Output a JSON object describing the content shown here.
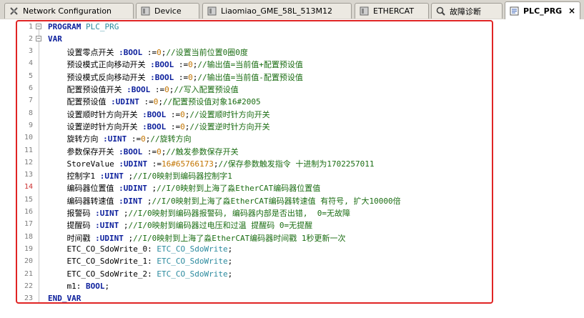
{
  "tabs": [
    {
      "label": "Network Configuration",
      "icon": "network-config-icon",
      "active": false
    },
    {
      "label": "Device",
      "icon": "device-icon",
      "active": false
    },
    {
      "label": "Liaomiao_GME_58L_513M12",
      "icon": "device-icon",
      "active": false
    },
    {
      "label": "ETHERCAT",
      "icon": "ethercat-icon",
      "active": false
    },
    {
      "label": "故障诊断",
      "icon": "diagnosis-icon",
      "active": false
    },
    {
      "label": "PLC_PRG",
      "icon": "program-icon",
      "active": true,
      "close": "×"
    }
  ],
  "editor": {
    "current_line": 14,
    "lines": [
      [
        {
          "t": "PROGRAM ",
          "c": "kw"
        },
        {
          "t": "PLC_PRG",
          "c": "ty"
        }
      ],
      [
        {
          "t": "VAR",
          "c": "kw"
        }
      ],
      [
        {
          "t": "    设置零点开关 ",
          "c": "ident"
        },
        {
          "t": ":BOOL",
          "c": "kw"
        },
        {
          "t": " :=",
          "c": "ident"
        },
        {
          "t": "0",
          "c": "num"
        },
        {
          "t": ";",
          "c": "ident"
        },
        {
          "t": "//设置当前位置0圈0度",
          "c": "cmt"
        }
      ],
      [
        {
          "t": "    预设模式正向移动开关 ",
          "c": "ident"
        },
        {
          "t": ":BOOL",
          "c": "kw"
        },
        {
          "t": " :=",
          "c": "ident"
        },
        {
          "t": "0",
          "c": "num"
        },
        {
          "t": ";",
          "c": "ident"
        },
        {
          "t": "//输出值=当前值+配置预设值",
          "c": "cmt"
        }
      ],
      [
        {
          "t": "    预设模式反向移动开关 ",
          "c": "ident"
        },
        {
          "t": ":BOOL",
          "c": "kw"
        },
        {
          "t": " :=",
          "c": "ident"
        },
        {
          "t": "0",
          "c": "num"
        },
        {
          "t": ";",
          "c": "ident"
        },
        {
          "t": "//输出值=当前值-配置预设值",
          "c": "cmt"
        }
      ],
      [
        {
          "t": "    配置预设值开关 ",
          "c": "ident"
        },
        {
          "t": ":BOOL",
          "c": "kw"
        },
        {
          "t": " :=",
          "c": "ident"
        },
        {
          "t": "0",
          "c": "num"
        },
        {
          "t": ";",
          "c": "ident"
        },
        {
          "t": "//写入配置预设值",
          "c": "cmt"
        }
      ],
      [
        {
          "t": "    配置预设值 ",
          "c": "ident"
        },
        {
          "t": ":UDINT",
          "c": "kw"
        },
        {
          "t": " :=",
          "c": "ident"
        },
        {
          "t": "0",
          "c": "num"
        },
        {
          "t": ";",
          "c": "ident"
        },
        {
          "t": "//配置预设值对象16#2005",
          "c": "cmt"
        }
      ],
      [
        {
          "t": "    设置顺时针方向开关 ",
          "c": "ident"
        },
        {
          "t": ":BOOL",
          "c": "kw"
        },
        {
          "t": " :=",
          "c": "ident"
        },
        {
          "t": "0",
          "c": "num"
        },
        {
          "t": ";",
          "c": "ident"
        },
        {
          "t": "//设置顺时针方向开关",
          "c": "cmt"
        }
      ],
      [
        {
          "t": "    设置逆时针方向开关 ",
          "c": "ident"
        },
        {
          "t": ":BOOL",
          "c": "kw"
        },
        {
          "t": " :=",
          "c": "ident"
        },
        {
          "t": "0",
          "c": "num"
        },
        {
          "t": ";",
          "c": "ident"
        },
        {
          "t": "//设置逆时针方向开关",
          "c": "cmt"
        }
      ],
      [
        {
          "t": "    旋转方向 ",
          "c": "ident"
        },
        {
          "t": ":UINT",
          "c": "kw"
        },
        {
          "t": " :=",
          "c": "ident"
        },
        {
          "t": "0",
          "c": "num"
        },
        {
          "t": ";",
          "c": "ident"
        },
        {
          "t": "//旋转方向",
          "c": "cmt"
        }
      ],
      [
        {
          "t": "    参数保存开关 ",
          "c": "ident"
        },
        {
          "t": ":BOOL",
          "c": "kw"
        },
        {
          "t": " :=",
          "c": "ident"
        },
        {
          "t": "0",
          "c": "num"
        },
        {
          "t": ";",
          "c": "ident"
        },
        {
          "t": "//触发参数保存开关",
          "c": "cmt"
        }
      ],
      [
        {
          "t": "    StoreValue ",
          "c": "ident"
        },
        {
          "t": ":UDINT",
          "c": "kw"
        },
        {
          "t": " :=",
          "c": "ident"
        },
        {
          "t": "16#65766173",
          "c": "num"
        },
        {
          "t": ";",
          "c": "ident"
        },
        {
          "t": "//保存参数触发指令 十进制为1702257011",
          "c": "cmt"
        }
      ],
      [
        {
          "t": "    控制字1 ",
          "c": "ident"
        },
        {
          "t": ":UINT",
          "c": "kw"
        },
        {
          "t": " ;",
          "c": "ident"
        },
        {
          "t": "//I/0映射到编码器控制字1",
          "c": "cmt"
        }
      ],
      [
        {
          "t": "    编码器位置值 ",
          "c": "ident"
        },
        {
          "t": ":UDINT",
          "c": "kw"
        },
        {
          "t": " ;",
          "c": "ident"
        },
        {
          "t": "//I/0映射到上海了淼EtherCAT编码器位置值",
          "c": "cmt"
        }
      ],
      [
        {
          "t": "    编码器转速值 ",
          "c": "ident"
        },
        {
          "t": ":DINT",
          "c": "kw"
        },
        {
          "t": " ;",
          "c": "ident"
        },
        {
          "t": "//I/0映射到上海了淼EtherCAT编码器转速值 有符号, 扩大10000倍",
          "c": "cmt"
        }
      ],
      [
        {
          "t": "    报警码 ",
          "c": "ident"
        },
        {
          "t": ":UINT",
          "c": "kw"
        },
        {
          "t": " ;",
          "c": "ident"
        },
        {
          "t": "//I/0映射到编码器报警码, 编码器内部是否出错,  0=无故障",
          "c": "cmt"
        }
      ],
      [
        {
          "t": "    提醒码 ",
          "c": "ident"
        },
        {
          "t": ":UINT",
          "c": "kw"
        },
        {
          "t": " ;",
          "c": "ident"
        },
        {
          "t": "//I/0映射到编码器过电压和过温 提醒码 0=无提醒",
          "c": "cmt"
        }
      ],
      [
        {
          "t": "    时间戳 ",
          "c": "ident"
        },
        {
          "t": ":UDINT",
          "c": "kw"
        },
        {
          "t": " ;",
          "c": "ident"
        },
        {
          "t": "//I/0映射到上海了淼EtherCAT编码器时间戳 1秒更新一次",
          "c": "cmt"
        }
      ],
      [
        {
          "t": "    ETC_CO_SdoWrite_0: ",
          "c": "ident"
        },
        {
          "t": "ETC_CO_SdoWrite",
          "c": "ty"
        },
        {
          "t": ";",
          "c": "ident"
        }
      ],
      [
        {
          "t": "    ETC_CO_SdoWrite_1: ",
          "c": "ident"
        },
        {
          "t": "ETC_CO_SdoWrite",
          "c": "ty"
        },
        {
          "t": ";",
          "c": "ident"
        }
      ],
      [
        {
          "t": "    ETC_CO_SdoWrite_2: ",
          "c": "ident"
        },
        {
          "t": "ETC_CO_SdoWrite",
          "c": "ty"
        },
        {
          "t": ";",
          "c": "ident"
        }
      ],
      [
        {
          "t": "    m1: ",
          "c": "ident"
        },
        {
          "t": "BOOL",
          "c": "kw"
        },
        {
          "t": ";",
          "c": "ident"
        }
      ],
      [
        {
          "t": "END_VAR",
          "c": "kw"
        }
      ]
    ]
  }
}
